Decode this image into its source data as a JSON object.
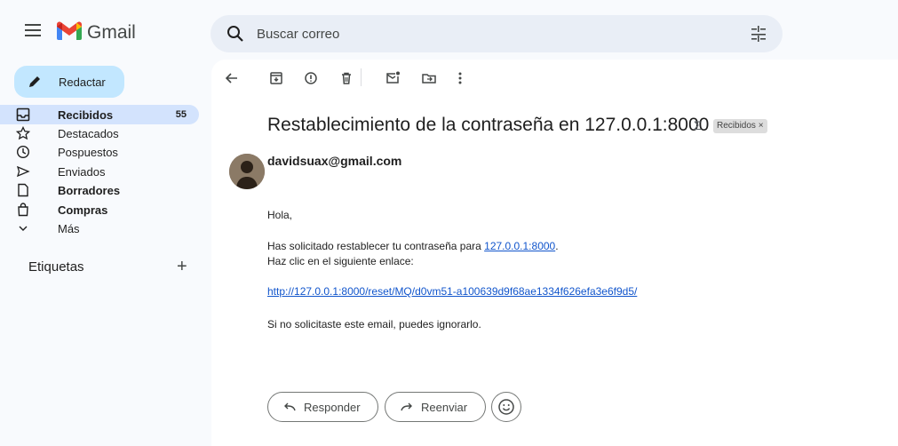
{
  "app": {
    "name": "Gmail"
  },
  "search": {
    "placeholder": "Buscar correo"
  },
  "compose": {
    "label": "Redactar"
  },
  "sidebar": {
    "items": [
      {
        "label": "Recibidos",
        "count": "55",
        "icon": "inbox-icon",
        "bold": true,
        "active": true
      },
      {
        "label": "Destacados",
        "icon": "star-icon"
      },
      {
        "label": "Pospuestos",
        "icon": "clock-icon"
      },
      {
        "label": "Enviados",
        "icon": "send-icon"
      },
      {
        "label": "Borradores",
        "icon": "draft-icon",
        "bold": true
      },
      {
        "label": "Compras",
        "icon": "shopping-icon",
        "bold": true
      },
      {
        "label": "Más",
        "icon": "chevron-down-icon"
      }
    ],
    "labels_title": "Etiquetas",
    "labels_add": "+"
  },
  "toolbar": {
    "icons": [
      "back-icon",
      "archive-icon",
      "report-spam-icon",
      "delete-icon",
      "mark-unread-icon",
      "move-to-icon",
      "more-icon"
    ]
  },
  "email": {
    "subject": "Restablecimiento de la contraseña en 127.0.0.1:8000",
    "label_chip": "Recibidos ×",
    "sender": "davidsuax@gmail.com",
    "greeting": "Hola,",
    "line1_prefix": "Has solicitado restablecer tu contraseña para ",
    "line1_link": "127.0.0.1:8000",
    "line1_suffix": ".",
    "line2": "Haz clic en el siguiente enlace:",
    "reset_link": "http://127.0.0.1:8000/reset/MQ/d0vm51-a100639d9f68ae1334f626efa3e6f9d5/",
    "closing": "Si no solicitaste este email, puedes ignorarlo."
  },
  "actions": {
    "reply": "Responder",
    "forward": "Reenviar"
  },
  "colors": {
    "compose_bg": "#c2e7ff",
    "active_nav": "#d3e3fd",
    "search_bg": "#e9eef6",
    "link": "#1155cc"
  }
}
